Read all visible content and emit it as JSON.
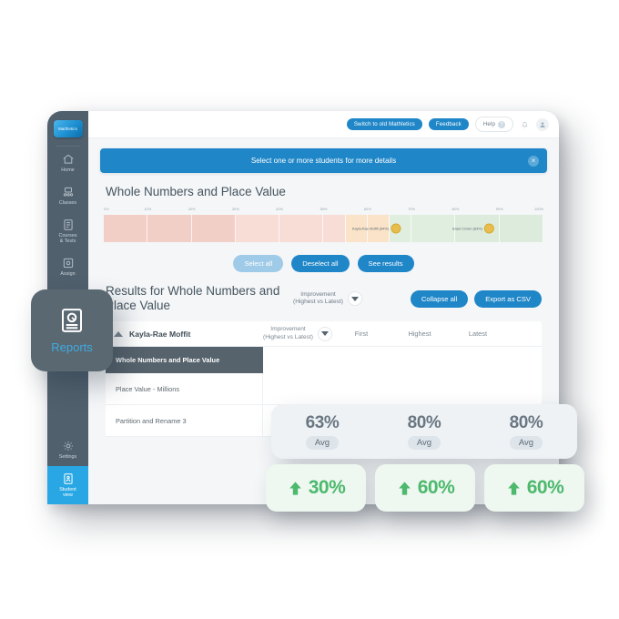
{
  "sidebar": {
    "logo": "Mathletics",
    "items": [
      {
        "label": "Home",
        "icon": "home-icon",
        "active": false
      },
      {
        "label": "Classes",
        "icon": "classes-icon",
        "active": false
      },
      {
        "label": "Courses\n& Tests",
        "icon": "courses-icon",
        "active": false
      },
      {
        "label": "Assign",
        "icon": "assign-icon",
        "active": false
      }
    ],
    "bottom_items": [
      {
        "label": "Settings",
        "icon": "gear-icon",
        "active": false
      },
      {
        "label": "Student\nview",
        "icon": "student-view-icon",
        "active": true
      }
    ]
  },
  "topbar": {
    "switch_label": "Switch to old Mathletics",
    "feedback_label": "Feedback",
    "help_label": "Help",
    "help_badge": "?",
    "bell_icon": "bell-icon",
    "avatar_icon": "user-avatar-icon"
  },
  "banner": {
    "text": "Select one or more students for more details",
    "close_icon": "×"
  },
  "section": {
    "title": "Whole Numbers and Place Value"
  },
  "chart_data": {
    "type": "bar",
    "title": "Whole Numbers and Place Value",
    "xlabel": "",
    "ylabel": "",
    "xlim": [
      0,
      100
    ],
    "grid": false,
    "tick_labels": [
      "0%",
      "10%",
      "20%",
      "30%",
      "40%",
      "50%",
      "60%",
      "70%",
      "80%",
      "90%",
      "100%"
    ],
    "tick_values": [
      0,
      10,
      20,
      30,
      40,
      50,
      60,
      70,
      80,
      90,
      100
    ],
    "bands": [
      {
        "from": 0,
        "to": 10,
        "color": "#f2cfc6"
      },
      {
        "from": 10,
        "to": 20,
        "color": "#f2cfc6"
      },
      {
        "from": 20,
        "to": 30,
        "color": "#f2cfc6"
      },
      {
        "from": 30,
        "to": 40,
        "color": "#f7ddd5"
      },
      {
        "from": 40,
        "to": 50,
        "color": "#f7ddd5"
      },
      {
        "from": 50,
        "to": 55,
        "color": "#f7ddd5"
      },
      {
        "from": 55,
        "to": 60,
        "color": "#fae3c8"
      },
      {
        "from": 60,
        "to": 65,
        "color": "#fae3c8"
      },
      {
        "from": 65,
        "to": 70,
        "color": "#dfeede"
      },
      {
        "from": 70,
        "to": 80,
        "color": "#dfeede"
      },
      {
        "from": 80,
        "to": 90,
        "color": "#dcebdc"
      },
      {
        "from": 90,
        "to": 100,
        "color": "#dcebdc"
      }
    ],
    "markers": [
      {
        "label": "Kayla-Rae Moffit (84%)",
        "value": 62,
        "color": "#e9bd4d"
      },
      {
        "label": "Israel Crown (83%)",
        "value": 84,
        "color": "#e9bd4d"
      }
    ]
  },
  "chart_buttons": {
    "select_all": "Select all",
    "deselect_all": "Deselect all",
    "see_results": "See results"
  },
  "results": {
    "title": "Results for Whole Numbers and Place Value",
    "sort_line1": "Improvement",
    "sort_line2": "(Highest vs Latest)",
    "collapse_all": "Collapse all",
    "export_csv": "Export as CSV"
  },
  "table": {
    "student_name": "Kayla-Rae Moffit",
    "sort_line1": "Improvement",
    "sort_line2": "(Highest vs Latest)",
    "columns": [
      "First",
      "Highest",
      "Latest"
    ],
    "rows": [
      {
        "name": "Whole Numbers and Place Value",
        "highlighted": true
      },
      {
        "name": "Place Value - Millions",
        "highlighted": false
      },
      {
        "name": "Partition and Rename 3",
        "highlighted": false
      }
    ]
  },
  "reports_card": {
    "label": "Reports",
    "icon": "report-icon"
  },
  "stats": {
    "averages": [
      {
        "value": "63%",
        "tag": "Avg"
      },
      {
        "value": "80%",
        "tag": "Avg"
      },
      {
        "value": "80%",
        "tag": "Avg"
      }
    ],
    "gains": [
      {
        "value": "30%",
        "icon": "arrow-up-icon"
      },
      {
        "value": "60%",
        "icon": "arrow-up-icon"
      },
      {
        "value": "60%",
        "icon": "arrow-up-icon"
      }
    ]
  },
  "colors": {
    "accent": "#1f86c8",
    "sidebar": "#50606d",
    "active": "#28a7e4",
    "green": "#4cb96d",
    "marker": "#e9bd4d"
  }
}
